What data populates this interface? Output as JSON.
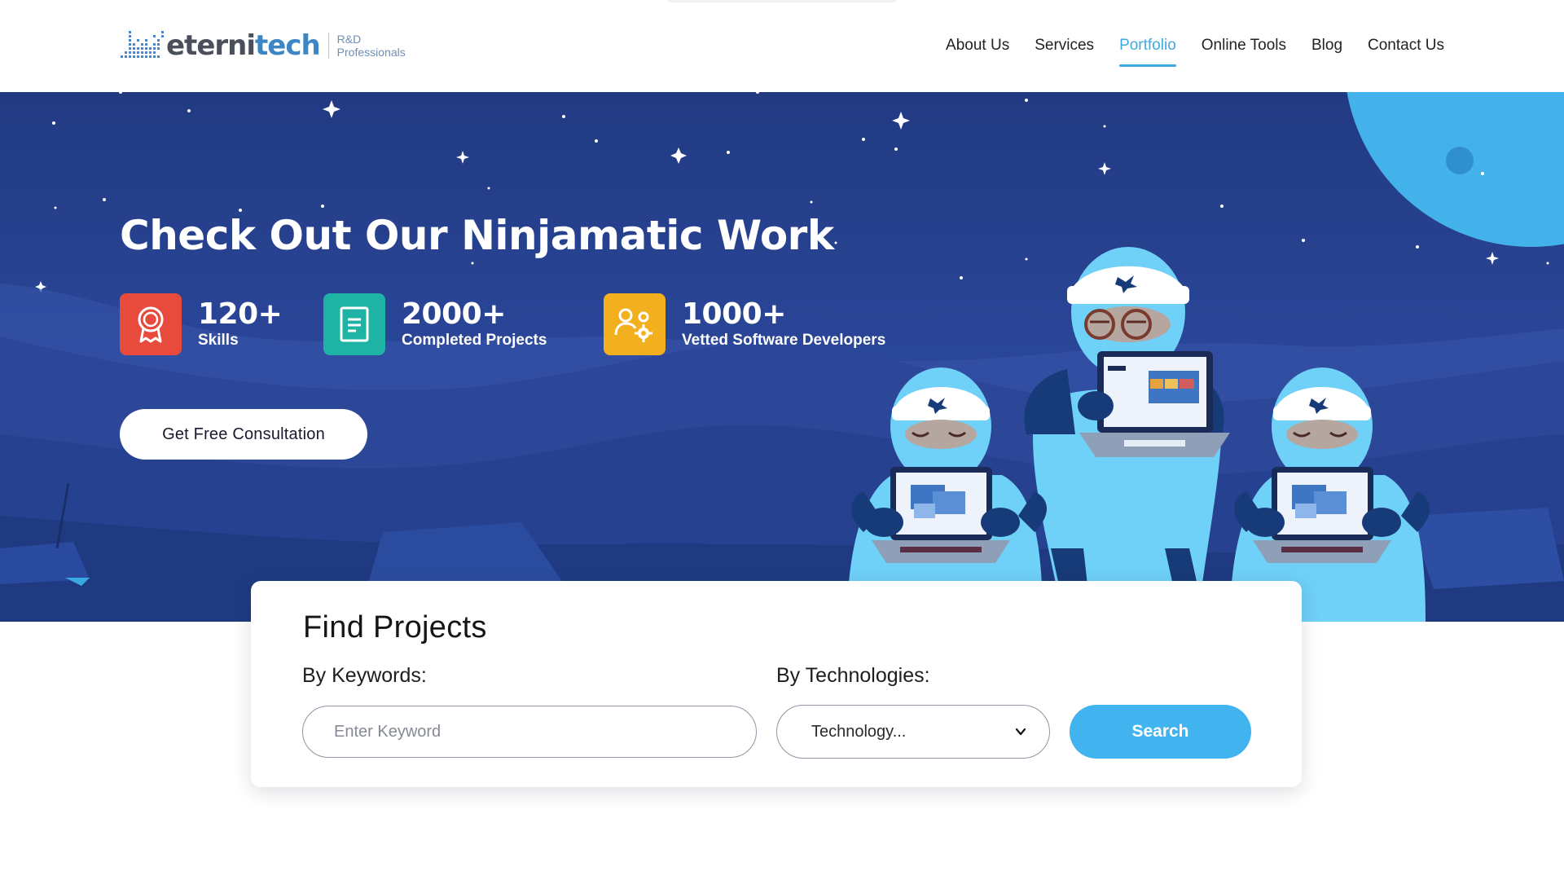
{
  "header": {
    "logo": {
      "name_part1": "eterni",
      "name_part2": "tech",
      "tagline_line1": "R&D",
      "tagline_line2": "Professionals"
    },
    "nav": [
      {
        "label": "About Us",
        "active": false
      },
      {
        "label": "Services",
        "active": false
      },
      {
        "label": "Portfolio",
        "active": true
      },
      {
        "label": "Online Tools",
        "active": false
      },
      {
        "label": "Blog",
        "active": false
      },
      {
        "label": "Contact Us",
        "active": false
      }
    ]
  },
  "hero": {
    "title": "Check Out Our Ninjamatic Work",
    "stats": [
      {
        "value": "120+",
        "label": "Skills",
        "icon": "award-ribbon-icon",
        "color": "#e84b3c"
      },
      {
        "value": "2000+",
        "label": "Completed Projects",
        "icon": "document-icon",
        "color": "#1fb3a6"
      },
      {
        "value": "1000+",
        "label": "Vetted Software Developers",
        "icon": "developers-gear-icon",
        "color": "#f2b01e"
      }
    ],
    "cta_label": "Get Free Consultation"
  },
  "search": {
    "title": "Find Projects",
    "keywords_label": "By Keywords:",
    "keyword_placeholder": "Enter Keyword",
    "technologies_label": "By Technologies:",
    "technology_selected": "Technology...",
    "button_label": "Search"
  },
  "colors": {
    "accent": "#3ea9df",
    "hero_bg": "#2a4596",
    "search_button": "#41b3ee",
    "ninja_light": "#6fd0f8",
    "ninja_dark": "#173a78"
  }
}
